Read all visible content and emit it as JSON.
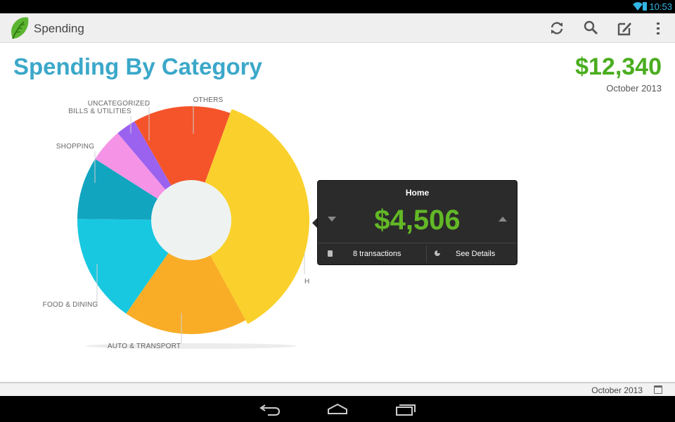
{
  "status_bar": {
    "time": "10:53"
  },
  "action_bar": {
    "title": "Spending",
    "icons": [
      "refresh-icon",
      "search-icon",
      "edit-icon",
      "overflow-menu-icon"
    ]
  },
  "header": {
    "title": "Spending By Category",
    "total": "$12,340",
    "period": "October 2013"
  },
  "chart_data": {
    "type": "pie",
    "categories": [
      "HOME",
      "AUTO & TRANSPORT",
      "FOOD & DINING",
      "SHOPPING",
      "BILLS & UTILITIES",
      "UNCATEGORIZED",
      "OTHERS"
    ],
    "values": [
      4506,
      2174,
      1910,
      1092,
      594,
      352,
      1712
    ],
    "colors": [
      "#fad12c",
      "#f9ad27",
      "#18c8e0",
      "#12a5c0",
      "#f593e6",
      "#9b62f0",
      "#f5542a"
    ],
    "selected": "HOME"
  },
  "popup": {
    "title": "Home",
    "amount": "$4,506",
    "transactions": "8 transactions",
    "details": "See Details"
  },
  "footer": {
    "period": "October 2013"
  },
  "colors": {
    "title": "#3ba8c9",
    "amount": "#4aad1f",
    "popup_amount": "#62b826"
  }
}
